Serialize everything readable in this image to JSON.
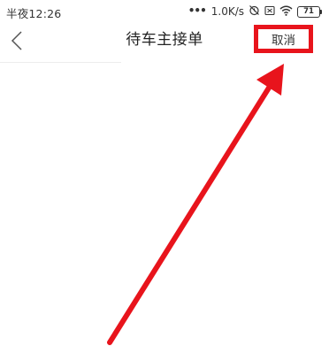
{
  "status_bar": {
    "time": "半夜12:26",
    "dots": "•••",
    "network_speed": "1.0K/s",
    "battery_level": "71",
    "icons": [
      "alarm-off-icon",
      "sim-off-icon",
      "wifi-icon",
      "battery-icon"
    ]
  },
  "nav": {
    "title": "待车主接单",
    "cancel_label": "取消",
    "back_icon": "chevron-left-icon"
  },
  "annotation": {
    "highlight_color": "#e8141c",
    "arrow_icon": "arrow-up-right-icon"
  }
}
